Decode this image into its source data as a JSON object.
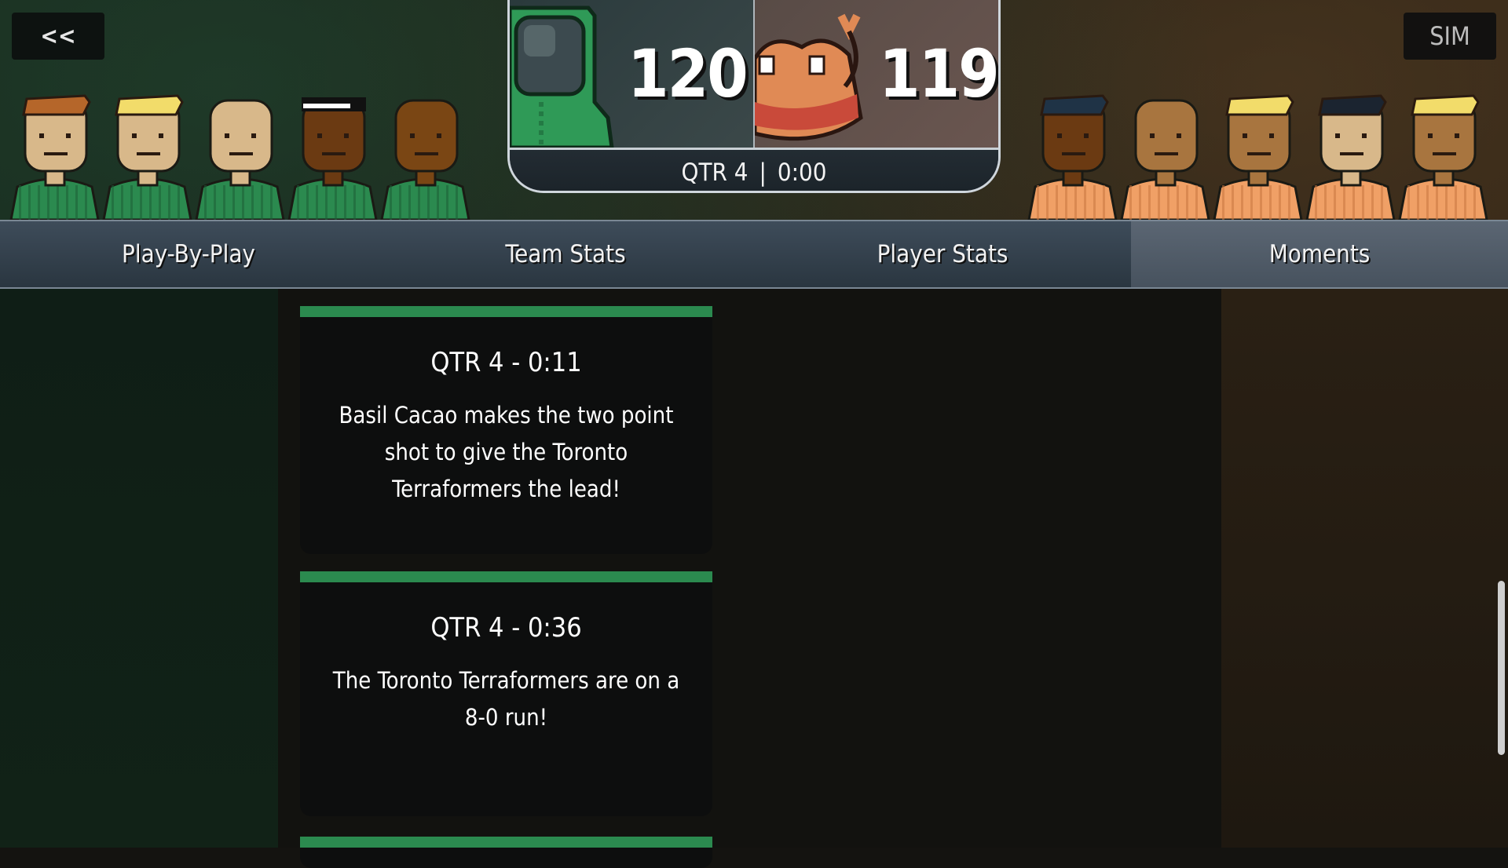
{
  "nav": {
    "back_label": "<<",
    "sim_label": "SIM"
  },
  "scoreboard": {
    "home_score": "120",
    "away_score": "119",
    "quarter": "QTR 4",
    "separator": "|",
    "clock": "0:00",
    "home_color": "#2b8a4f",
    "away_color": "#f0a066"
  },
  "tabs": [
    "Play-By-Play",
    "Team Stats",
    "Player Stats",
    "Moments"
  ],
  "active_tab": "Moments",
  "rosters": {
    "home": [
      {
        "skin": "#d8b88a",
        "hair": "#b5662a"
      },
      {
        "skin": "#d8b88a",
        "hair": "#f2dc6a"
      },
      {
        "skin": "#d8b88a",
        "hair": "none"
      },
      {
        "skin": "#6b3a12",
        "hair": "headband"
      },
      {
        "skin": "#7a4614",
        "hair": "none"
      }
    ],
    "away": [
      {
        "skin": "#6b3a12",
        "hair": "#1f3346"
      },
      {
        "skin": "#a8753f",
        "hair": "none"
      },
      {
        "skin": "#a8753f",
        "hair": "#f2dc6a"
      },
      {
        "skin": "#d8b88a",
        "hair": "#1b2430"
      },
      {
        "skin": "#a8753f",
        "hair": "#f2dc6a"
      }
    ]
  },
  "moments": [
    {
      "time": "QTR 4 - 0:11",
      "text": "Basil Cacao makes the two point shot to give the Toronto Terraformers the lead!"
    },
    {
      "time": "QTR 4 - 0:36",
      "text": "The Toronto Terraformers are on a 8-0 run!"
    },
    {
      "time": "",
      "text": ""
    }
  ]
}
